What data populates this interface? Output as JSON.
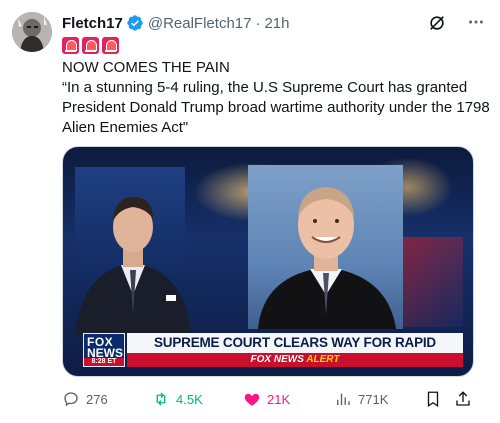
{
  "author": {
    "name": "Fletch17",
    "handle": "@RealFletch17",
    "separator": "·",
    "time": "21h"
  },
  "tweet": {
    "line1": "NOW COMES THE PAIN",
    "line2": "“In a stunning 5-4 ruling, the U.S Supreme Court has granted President Donald Trump broad wartime authority under the 1798 Alien Enemies Act\""
  },
  "media": {
    "logo_top": "FOX",
    "logo_bottom": "NEWS",
    "logo_time": "8:28 ET",
    "headline": "SUPREME COURT CLEARS WAY FOR RAPID DEPORTATIONS",
    "ticker_brand": "FOX NEWS",
    "ticker_alert": "ALERT"
  },
  "actions": {
    "replies": "276",
    "reposts": "4.5K",
    "likes": "21K",
    "views": "771K"
  },
  "colors": {
    "verified": "#1d9bf0",
    "repost": "#00ba7c",
    "like": "#f91880",
    "muted": "#536471"
  },
  "icons": [
    "grok-icon",
    "more-icon",
    "reply-icon",
    "repost-icon",
    "like-icon",
    "views-icon",
    "bookmark-icon",
    "share-icon",
    "siren-icon"
  ]
}
